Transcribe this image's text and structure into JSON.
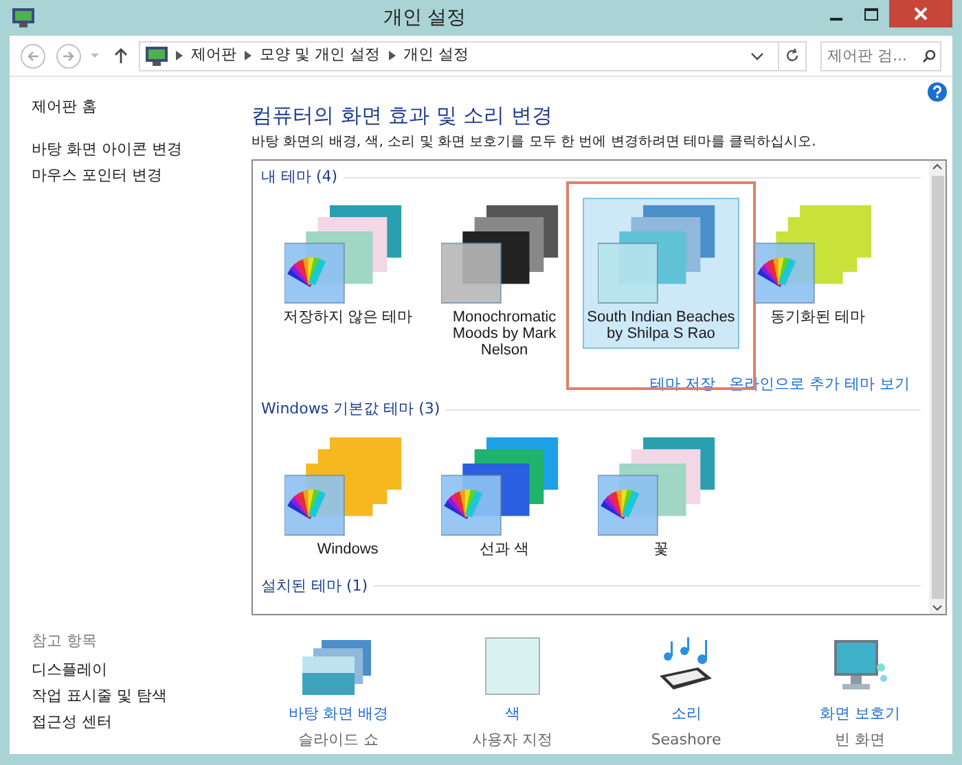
{
  "window": {
    "title": "개인 설정"
  },
  "address_bar": {
    "crumbs": [
      "제어판",
      "모양 및 개인 설정",
      "개인 설정"
    ]
  },
  "search": {
    "placeholder": "제어판 검..."
  },
  "sidebar": {
    "items": [
      "제어판 홈",
      "바탕 화면 아이콘 변경",
      "마우스 포인터 변경"
    ],
    "see_also": {
      "title": "참고 항목",
      "items": [
        "디스플레이",
        "작업 표시줄 및 탐색",
        "접근성 센터"
      ]
    }
  },
  "main": {
    "heading": "컴퓨터의 화면 효과 및 소리 변경",
    "description": "바탕 화면의 배경, 색, 소리 및 화면 보호기를 모두 한 번에 변경하려면 테마를 클릭하십시오."
  },
  "theme_groups": [
    {
      "title": "내 테마 (4)",
      "themes": [
        {
          "name": "저장하지 않은 테마",
          "selected": false
        },
        {
          "name": "Monochromatic Moods by Mark Nelson",
          "selected": false
        },
        {
          "name": "South Indian Beaches by Shilpa S Rao",
          "selected": true
        },
        {
          "name": "동기화된 테마",
          "selected": false
        }
      ],
      "links": [
        "테마 저장",
        "온라인으로 추가 테마 보기"
      ]
    },
    {
      "title": "Windows 기본값 테마 (3)",
      "themes": [
        {
          "name": "Windows",
          "selected": false
        },
        {
          "name": "선과 색",
          "selected": false
        },
        {
          "name": "꽃",
          "selected": false
        }
      ]
    },
    {
      "title": "설치된 테마 (1)"
    }
  ],
  "bottom_items": [
    {
      "label": "바탕 화면 배경",
      "value": "슬라이드 쇼"
    },
    {
      "label": "색",
      "value": "사용자 지정"
    },
    {
      "label": "소리",
      "value": "Seashore"
    },
    {
      "label": "화면 보호기",
      "value": "빈 화면"
    }
  ]
}
